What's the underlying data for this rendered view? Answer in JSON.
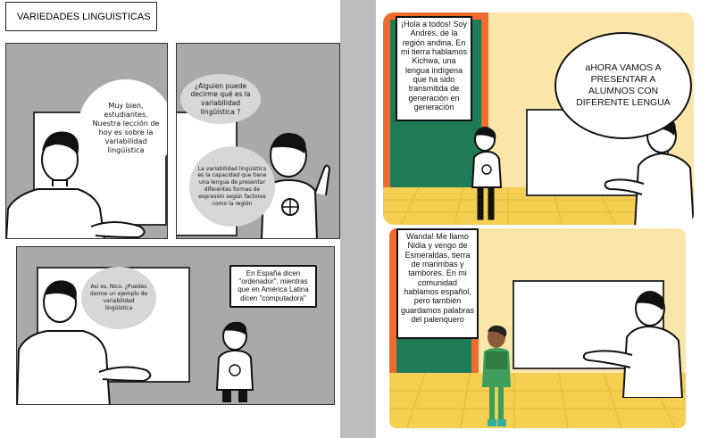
{
  "left_page": {
    "title": "VARIEDADES LINGUISTICAS",
    "panel1_bubble": "Muy bien, estudiantes. Nuestra lección de hoy es sobre la variabilidad lingüística",
    "panel2_question": "¿Alguien puede decirme qué es la variabilidad lingüística ?",
    "panel2_answer": "La variabilidad lingüística es la capacidad que tiene una lengua de presentar diferentes formas de expresión según factores como la región",
    "panel3_teacher": "Así es, Nico. ¿Puedes darme un ejemplo de variabilidad lingüística",
    "panel3_student": "En España dicen \"ordenador\", mientras que en América Latina dicen \"computadora\""
  },
  "right_page": {
    "panel1_student": "¡Hola a todos! Soy Andrés, de la región andina. En mi tierra hablamos Kichwa, una lengua indígena que ha sido transmitida de generación en generación",
    "panel1_teacher": "aHORA VAMOS A PRESENTAR A ALUMNOS CON DIFERENTE LENGUA",
    "panel2_student": "Wanda! Me llamo Nidia y vengo de Esmeraldas, tierra de marimbas y tambores. En mi comunidad hablamos español, pero también guardamos palabras del palenquero"
  },
  "colors": {
    "panel_gray": "#a9a9a9",
    "speech_gray": "#d7d7d7",
    "classroom_yellow": "#f9e6a8",
    "floor_yellow": "#f5cf52",
    "wall_green": "#1f7a56",
    "wall_orange": "#ef6a2c"
  }
}
